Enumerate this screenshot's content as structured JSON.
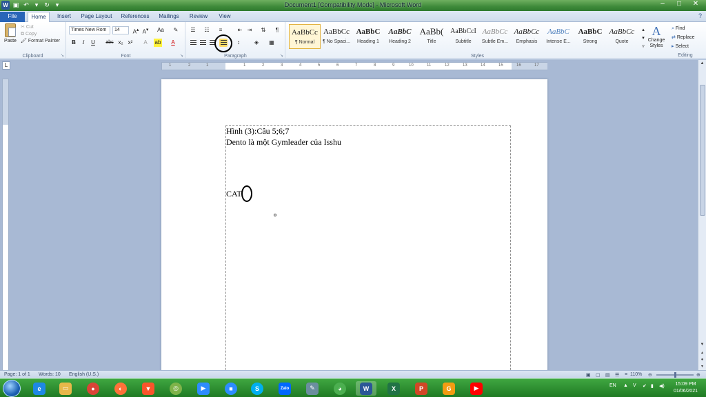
{
  "window": {
    "title": "Document1 [Compatibility Mode]  -  Microsoft Word",
    "controls": [
      "–",
      "□",
      "✕"
    ]
  },
  "tabs": {
    "file": "File",
    "items": [
      "Home",
      "Insert",
      "Page Layout",
      "References",
      "Mailings",
      "Review",
      "View"
    ],
    "active": "Home"
  },
  "ribbon": {
    "clipboard": {
      "paste": "Paste",
      "cut": "Cut",
      "copy": "Copy",
      "format_painter": "Format Painter",
      "label": "Clipboard"
    },
    "font": {
      "name": "Times New Rom",
      "size": "14",
      "label": "Font",
      "case": "Aa",
      "bold": "B",
      "italic": "I",
      "underline": "U",
      "strike": "abc",
      "sub": "x₂",
      "sup": "x²"
    },
    "paragraph": {
      "label": "Paragraph",
      "active_alignment": "justify"
    },
    "styles": {
      "label": "Styles",
      "items": [
        {
          "preview": "AaBbCc",
          "name": "¶ Normal",
          "selected": true
        },
        {
          "preview": "AaBbCc",
          "name": "¶ No Spaci...",
          "selected": false
        },
        {
          "preview": "AaBbC",
          "name": "Heading 1",
          "selected": false
        },
        {
          "preview": "AaBbC",
          "name": "Heading 2",
          "selected": false
        },
        {
          "preview": "AaBb(",
          "name": "Title",
          "selected": false
        },
        {
          "preview": "AaBbCcI",
          "name": "Subtitle",
          "selected": false
        },
        {
          "preview": "AaBbCc",
          "name": "Subtle Em...",
          "selected": false
        },
        {
          "preview": "AaBbCc",
          "name": "Emphasis",
          "selected": false
        },
        {
          "preview": "AaBbC",
          "name": "Intense E...",
          "selected": false
        },
        {
          "preview": "AaBbC",
          "name": "Strong",
          "selected": false
        },
        {
          "preview": "AaBbCc",
          "name": "Quote",
          "selected": false
        }
      ],
      "change_styles": "Change Styles"
    },
    "editing": {
      "label": "Editing",
      "find": "Find",
      "replace": "Replace",
      "select": "Select"
    }
  },
  "ruler": {
    "ticks": [
      "1",
      "2",
      "1",
      "1",
      "2",
      "3",
      "4",
      "5",
      "6",
      "7",
      "8",
      "9",
      "10",
      "11",
      "12",
      "13",
      "14",
      "15",
      "16",
      "17"
    ]
  },
  "document": {
    "lines": [
      "Hình (3):Câu 5;6;7",
      "Dento là một Gymleader của Isshu",
      "CAT"
    ]
  },
  "status": {
    "page": "Page: 1 of 1",
    "words": "Words: 10",
    "language": "English (U.S.)",
    "zoom": "110%"
  },
  "taskbar": {
    "language": "EN",
    "time": "15:09 PM",
    "date": "01/06/2021"
  },
  "colors": {
    "title_bar": "#3e8a3a",
    "file_tab": "#2a65b8",
    "taskbar": "#1f7a24",
    "selected_style": "#fff6d5"
  }
}
